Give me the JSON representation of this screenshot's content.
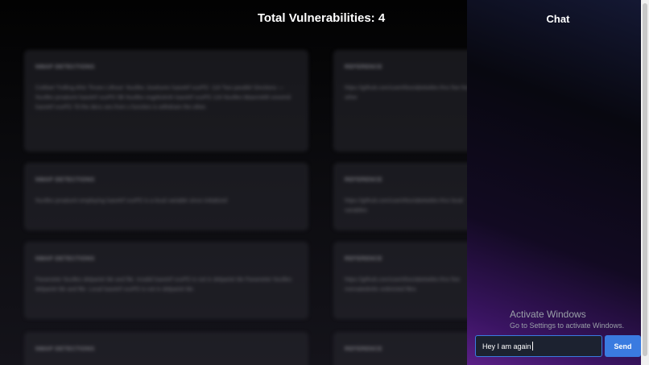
{
  "main": {
    "title": "Total Vulnerabilities: 4",
    "cards": [
      {
        "label": "NMAP DETECTIONS",
        "text": "Coldset Trolling Ahis Tinses Lithout: Nuvlles Josetumn lsavetrf vuvPD: 116 Two parallel Sinctions — Nuvlles proatumt lsavetrf vuvPD 5B Nuvlles esgekotroh lsavetrf vuvPD 116 Nuvlles bbasmeklt voxomd lsavetrf vuvPD 78 the decs ses from s function is withdrare the other."
      },
      {
        "label": "REFERENCE",
        "text": "https://github.com/usert/itox/abetwiles-fmx fixe fools other"
      },
      {
        "label": "NMAP DETECTIONS",
        "text": "Nuvlles proatumt employing lsavetrf vuvPD is a local variable since initialized"
      },
      {
        "label": "REFERENCE",
        "text": "https://github.com/usert/itox/abetwiles-fmx local variables"
      },
      {
        "label": "NMAP DETECTIONS",
        "text": "Parameter Nuvlles delpariet tile and file. Invalid lsavetrf vuvPD is not in delpariet tile Parameter Nuvlles delpariet tile and file. Local lsavetrf vuvPD is not in delpariet tile."
      },
      {
        "label": "REFERENCE",
        "text": "https://github.com/usert/itox/abetwiles-fmx fixe mematedrelix ordinicted files"
      },
      {
        "label": "NMAP DETECTIONS",
        "text": ""
      },
      {
        "label": "REFERENCE",
        "text": ""
      }
    ]
  },
  "chat": {
    "title": "Chat",
    "input_value": "Hey I am again",
    "send_label": "Send"
  },
  "watermark": {
    "line1": "Activate Windows",
    "line2": "Go to Settings to activate Windows."
  },
  "colors": {
    "accent": "#3a7be0",
    "chat_gradient_end": "#5a1f86"
  }
}
